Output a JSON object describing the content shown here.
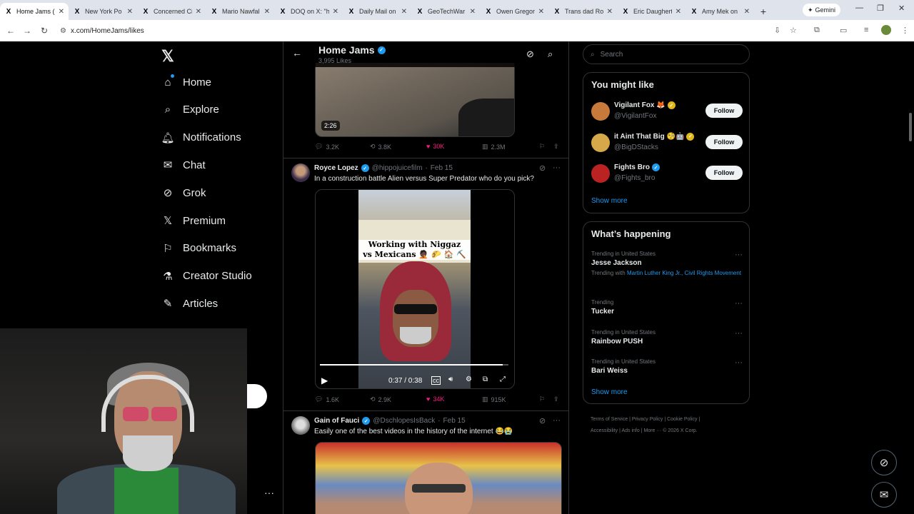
{
  "browser": {
    "tabs": [
      {
        "title": "Home Jams (@",
        "active": true
      },
      {
        "title": "New York Po"
      },
      {
        "title": "Concerned Ci"
      },
      {
        "title": "Mario Nawfal"
      },
      {
        "title": "DOQ on X: \"h"
      },
      {
        "title": "Daily Mail on"
      },
      {
        "title": "GeoTechWar"
      },
      {
        "title": "Owen Gregor"
      },
      {
        "title": "Trans dad Rol"
      },
      {
        "title": "Eric Daughert"
      },
      {
        "title": "Amy Mek on"
      }
    ],
    "gemini_label": "Gemini",
    "url": "x.com/HomeJams/likes"
  },
  "nav": {
    "items": [
      {
        "label": "Home",
        "icon": "home-icon"
      },
      {
        "label": "Explore",
        "icon": "search-icon"
      },
      {
        "label": "Notifications",
        "icon": "bell-icon"
      },
      {
        "label": "Chat",
        "icon": "mail-icon"
      },
      {
        "label": "Grok",
        "icon": "grok-icon"
      },
      {
        "label": "Premium",
        "icon": "x-icon"
      },
      {
        "label": "Bookmarks",
        "icon": "bookmark-icon"
      },
      {
        "label": "Creator Studio",
        "icon": "flask-icon"
      },
      {
        "label": "Articles",
        "icon": "article-icon"
      }
    ]
  },
  "header": {
    "name": "Home Jams",
    "subtitle": "3,995 Likes"
  },
  "post1": {
    "duration": "2:26",
    "replies": "3.2K",
    "reposts": "3.8K",
    "likes": "30K",
    "views": "2.3M"
  },
  "post2": {
    "author": "Royce Lopez",
    "handle": "@hippojuicefilm",
    "date": "Feb 15",
    "text": "In a construction battle Alien versus Super Predator who do you pick?",
    "video_caption_line1": "Working with Niggaz",
    "video_caption_line2": "vs Mexicans 🤦🏿 🌮 🏠 ⛏️",
    "time": "0:37 / 0:38",
    "progress": 0.97,
    "replies": "1.6K",
    "reposts": "2.9K",
    "likes": "34K",
    "views": "915K"
  },
  "post3": {
    "author": "Gain of Fauci",
    "handle": "@DschlopesIsBack",
    "date": "Feb 15",
    "text": "Easily one of the best videos in the history of the internet 😂😭"
  },
  "sidebar": {
    "search_placeholder": "Search",
    "you_might_like": "You might like",
    "suggestions": [
      {
        "name": "Vigilant Fox 🦊",
        "handle": "@VigilantFox",
        "badge": "gold",
        "follow": "Follow"
      },
      {
        "name": "it Aint That Big 🧐🤖",
        "handle": "@BigDStacks",
        "badge": "gold",
        "follow": "Follow"
      },
      {
        "name": "Fights Bro",
        "handle": "@Fights_bro",
        "badge": "blue",
        "follow": "Follow"
      }
    ],
    "show_more": "Show more",
    "whats_happening": "What’s happening",
    "trends": [
      {
        "context": "Trending in United States",
        "name": "Jesse Jackson",
        "with_label": "Trending with",
        "with": "Martin Luther King Jr., Civil Rights Movement"
      },
      {
        "context": "Trending",
        "name": "Tucker"
      },
      {
        "context": "Trending in United States",
        "name": "Rainbow PUSH"
      },
      {
        "context": "Trending in United States",
        "name": "Bari Weiss"
      }
    ],
    "show_more2": "Show more",
    "footer_line1": "Terms of Service  |  Privacy Policy  |  Cookie Policy  |",
    "footer_line2": "Accessibility  |  Ads info  |  More ···  © 2026 X Corp."
  },
  "colors": {
    "accent": "#1d9bf0",
    "like": "#f91880",
    "gold": "#e2b719"
  }
}
